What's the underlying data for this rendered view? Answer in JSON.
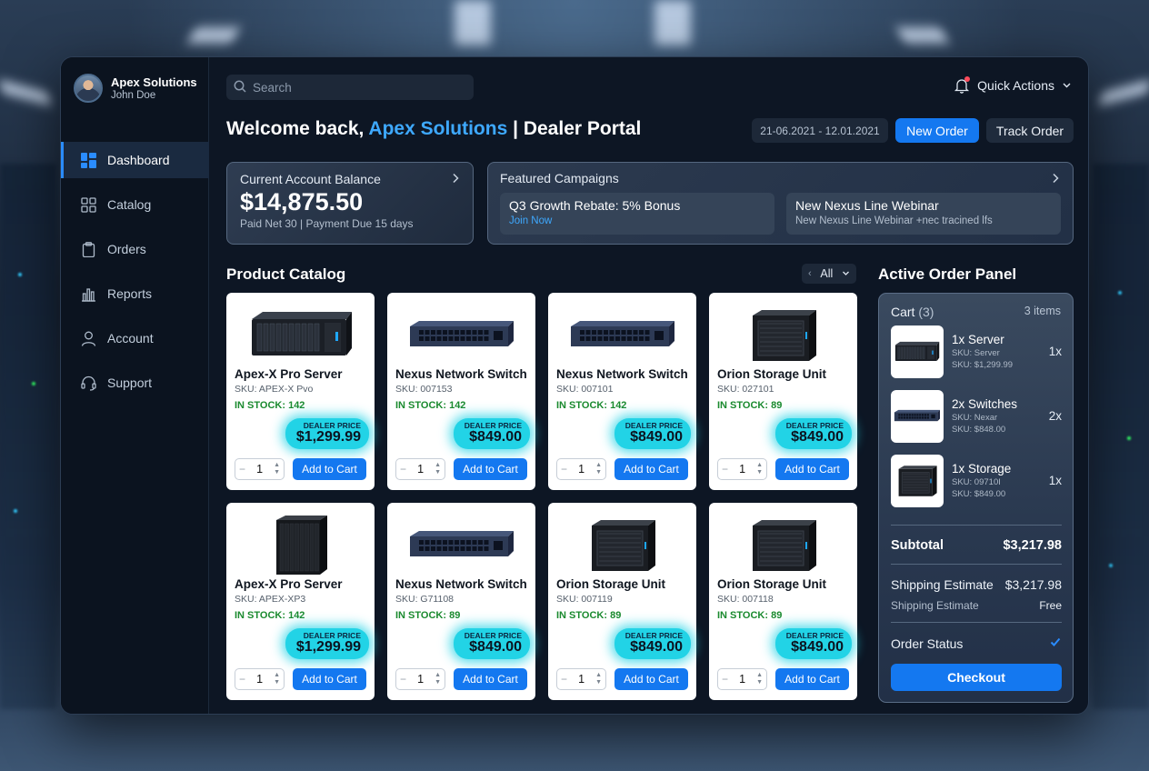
{
  "profile": {
    "company": "Apex Solutions",
    "user": "John Doe"
  },
  "nav": [
    {
      "label": "Dashboard",
      "icon": "dashboard-icon",
      "active": true
    },
    {
      "label": "Catalog",
      "icon": "grid-icon"
    },
    {
      "label": "Orders",
      "icon": "clipboard-icon"
    },
    {
      "label": "Reports",
      "icon": "bar-chart-icon"
    },
    {
      "label": "Account",
      "icon": "user-icon"
    },
    {
      "label": "Support",
      "icon": "headset-icon"
    }
  ],
  "header": {
    "search_placeholder": "Search",
    "quick_actions": "Quick Actions",
    "welcome_prefix": "Welcome back,",
    "welcome_company": "Apex Solutions",
    "welcome_suffix": "| Dealer Portal",
    "date_range": "21-06.2021 - 12.01.2021",
    "new_order": "New Order",
    "track_order": "Track Order"
  },
  "balance": {
    "title": "Current Account Balance",
    "amount": "$14,875.50",
    "terms": "Paid Net 30 | Payment Due 15 days"
  },
  "campaigns": {
    "title": "Featured Campaigns",
    "items": [
      {
        "title": "Q3 Growth Rebate: 5% Bonus",
        "sub": "Join Now"
      },
      {
        "title": "New Nexus Line Webinar",
        "sub": "New Nexus Line Webinar +nec tracined lfs"
      }
    ]
  },
  "catalog": {
    "title": "Product Catalog",
    "filter": "All",
    "price_label": "DEALER PRICE",
    "add_label": "Add to Cart",
    "products": [
      {
        "name": "Apex-X Pro Server",
        "sku": "SKU: APEX-X Pvo",
        "stock": "IN STOCK: 142",
        "price": "$1,299.99",
        "qty": "1",
        "img": "rack-server"
      },
      {
        "name": "Nexus Network Switch",
        "sku": "SKU: 007153",
        "stock": "IN STOCK: 142",
        "price": "$849.00",
        "qty": "1",
        "img": "switch"
      },
      {
        "name": "Nexus Network Switch",
        "sku": "SKU: 007101",
        "stock": "IN STOCK: 142",
        "price": "$849.00",
        "qty": "1",
        "img": "switch"
      },
      {
        "name": "Orion Storage Unit",
        "sku": "SKU: 027101",
        "stock": "IN STOCK: 89",
        "price": "$849.00",
        "qty": "1",
        "img": "storage"
      },
      {
        "name": "Apex-X Pro Server",
        "sku": "SKU: APEX-XP3",
        "stock": "IN STOCK: 142",
        "price": "$1,299.99",
        "qty": "1",
        "img": "tower"
      },
      {
        "name": "Nexus Network Switch",
        "sku": "SKU: G71108",
        "stock": "IN STOCK: 89",
        "price": "$849.00",
        "qty": "1",
        "img": "switch"
      },
      {
        "name": "Orion Storage Unit",
        "sku": "SKU: 007119",
        "stock": "IN STOCK: 89",
        "price": "$849.00",
        "qty": "1",
        "img": "storage"
      },
      {
        "name": "Orion Storage Unit",
        "sku": "SKU: 007118",
        "stock": "IN STOCK: 89",
        "price": "$849.00",
        "qty": "1",
        "img": "storage"
      }
    ]
  },
  "order_panel": {
    "title": "Active Order Panel",
    "cart_label": "Cart",
    "cart_count": "(3)",
    "items_label": "3 items",
    "items": [
      {
        "name": "1x Server",
        "sku1": "SKU: Server",
        "sku2": "SKU: $1,299.99",
        "qty": "1x",
        "img": "rack-server"
      },
      {
        "name": "2x Switches",
        "sku1": "SKU: Nexar",
        "sku2": "SKU: $848.00",
        "qty": "2x",
        "img": "switch"
      },
      {
        "name": "1x Storage",
        "sku1": "SKU: 09710I",
        "sku2": "SKU: $849.00",
        "qty": "1x",
        "img": "storage"
      }
    ],
    "subtotal_label": "Subtotal",
    "subtotal_value": "$3,217.98",
    "shipping_label": "Shipping Estimate",
    "shipping_value": "$3,217.98",
    "shipping_label2": "Shipping Estimate",
    "shipping_value2": "Free",
    "status_label": "Order Status",
    "checkout": "Checkout"
  },
  "colors": {
    "accent": "#1478f0",
    "highlight": "#3ea9ff",
    "price_glow": "#22d3e6",
    "stock": "#1a8a2e"
  }
}
